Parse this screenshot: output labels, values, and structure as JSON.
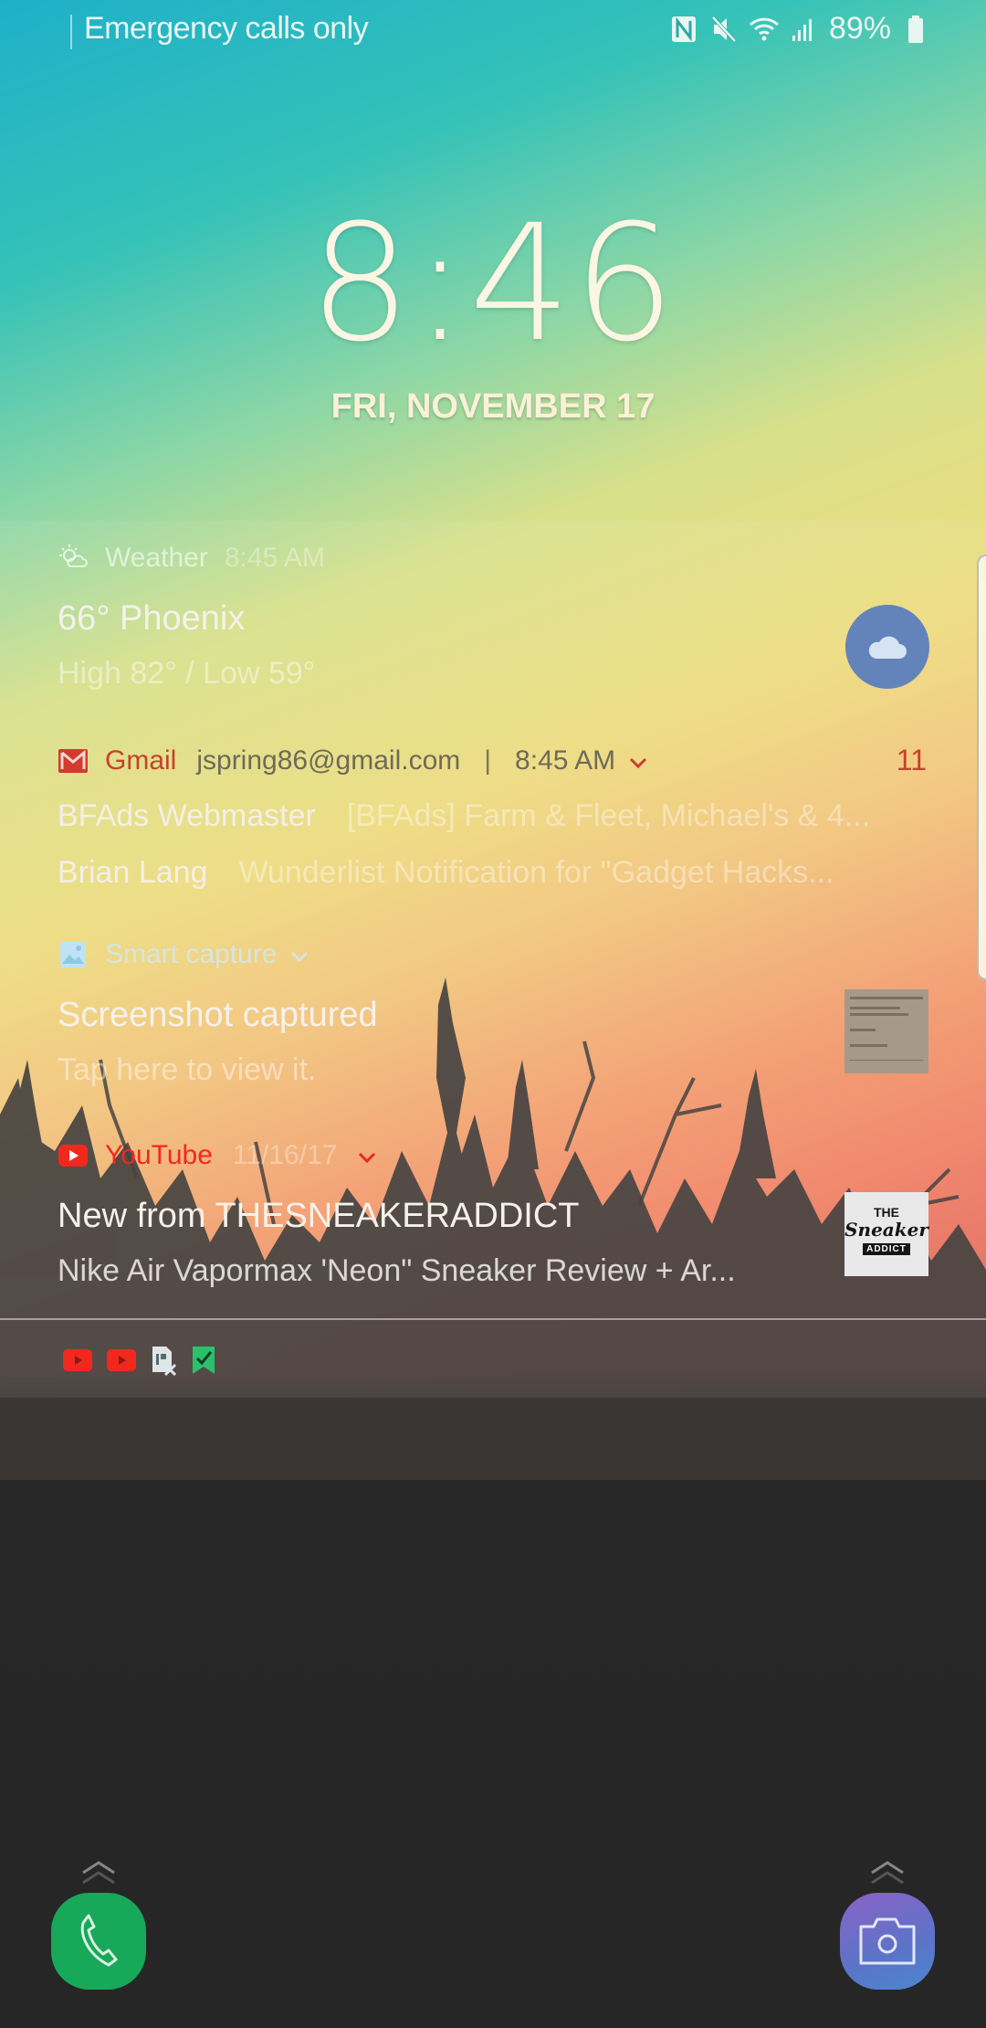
{
  "status_bar": {
    "carrier_text": "Emergency calls only",
    "icons": [
      "nfc-icon",
      "mute-icon",
      "wifi-icon",
      "signal-icon",
      "battery-icon"
    ],
    "battery_percent": "89%"
  },
  "lock_screen": {
    "time": "8:46",
    "date": "FRI, NOVEMBER 17"
  },
  "notifications": {
    "weather": {
      "app": "Weather",
      "time": "8:45 AM",
      "title": "66° Phoenix",
      "subtitle": "High 82° / Low 59°",
      "icon": "cloud-icon",
      "badge_color": "#6383bb"
    },
    "gmail": {
      "app": "Gmail",
      "account": "jspring86@gmail.com",
      "separator": "|",
      "time": "8:45 AM",
      "count": "11",
      "accent_color": "#c8402e",
      "messages": [
        {
          "sender": "BFAds Webmaster",
          "subject": "[BFAds] Farm & Fleet, Michael's & 4..."
        },
        {
          "sender": "Brian Lang",
          "subject": "Wunderlist Notification for \"Gadget Hacks..."
        }
      ]
    },
    "smart_capture": {
      "app": "Smart capture",
      "title": "Screenshot captured",
      "subtitle": "Tap here to view it."
    },
    "youtube": {
      "app": "YouTube",
      "date": "11/16/17",
      "title": "New from THESNEAKERADDICT",
      "subtitle": "Nike Air Vapormax 'Neon\" Sneaker Review + Ar...",
      "thumb_text_top": "THE",
      "thumb_text_mid": "Sneaker",
      "thumb_text_bottom": "ADDICT",
      "accent_color": "#f2281f"
    }
  },
  "overflow_icons": [
    "youtube-icon",
    "youtube-icon",
    "sim-card-missing-icon",
    "wunderlist-icon"
  ],
  "shortcuts": {
    "left": "phone",
    "right": "camera"
  }
}
